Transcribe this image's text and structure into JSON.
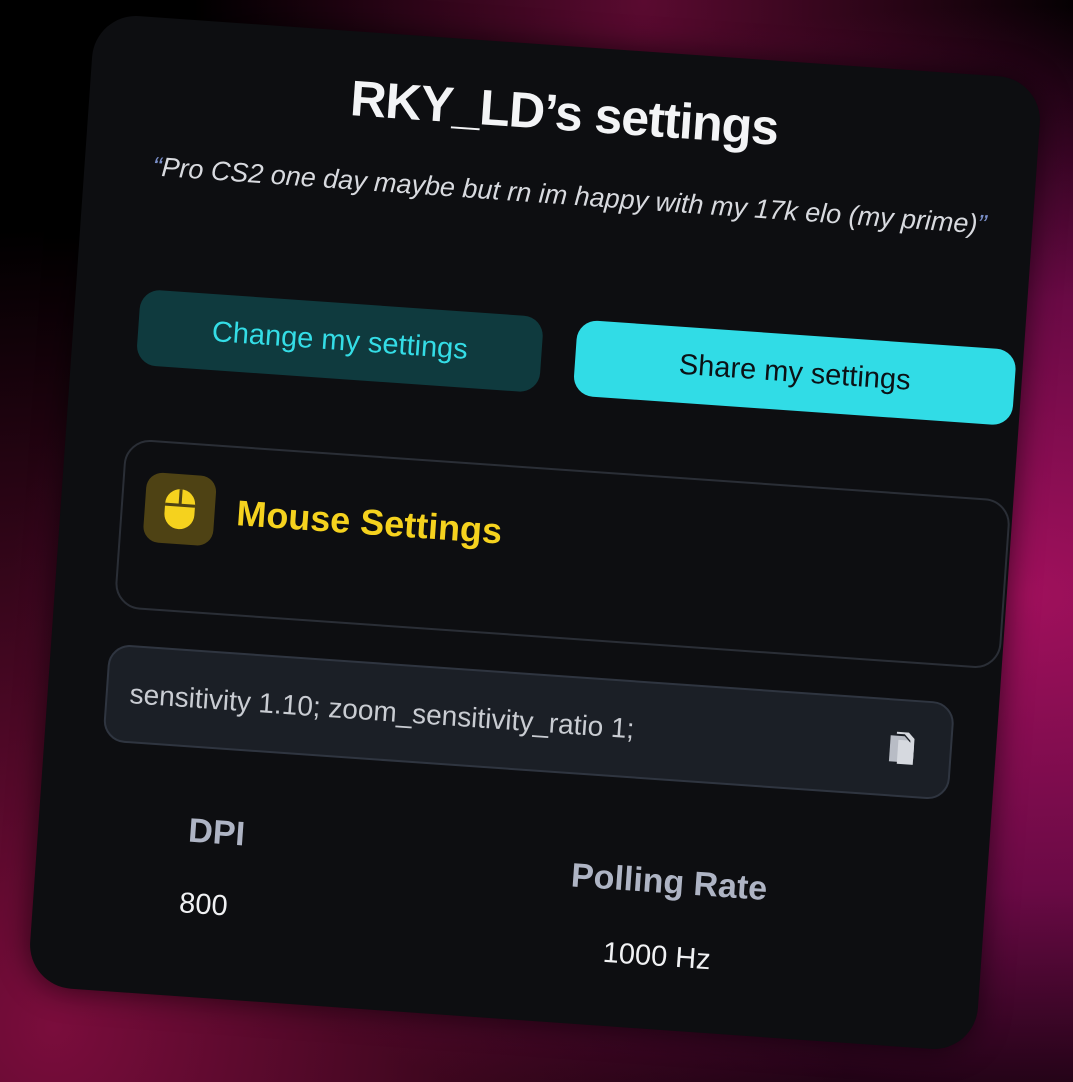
{
  "page": {
    "title": "RKY_LD’s settings",
    "quote_open": "“",
    "quote_text": "Pro CS2  one day maybe but rn im happy with my 17k elo (my prime)",
    "quote_close": "”"
  },
  "actions": {
    "change_label": "Change my settings",
    "share_label": "Share my settings"
  },
  "mouse_section": {
    "icon": "mouse-icon",
    "title": "Mouse Settings"
  },
  "command": {
    "text": "sensitivity 1.10; zoom_sensitivity_ratio 1;",
    "copy_icon": "copy-icon"
  },
  "stats": {
    "dpi_label": "DPI",
    "dpi_value": "800",
    "polling_label": "Polling Rate",
    "polling_value": "1000 Hz"
  },
  "colors": {
    "accent_cyan": "#31dce6",
    "accent_dark_cyan": "#0f3a3e",
    "mouse_yellow": "#f5d21e",
    "card_bg": "#0d0e11"
  }
}
